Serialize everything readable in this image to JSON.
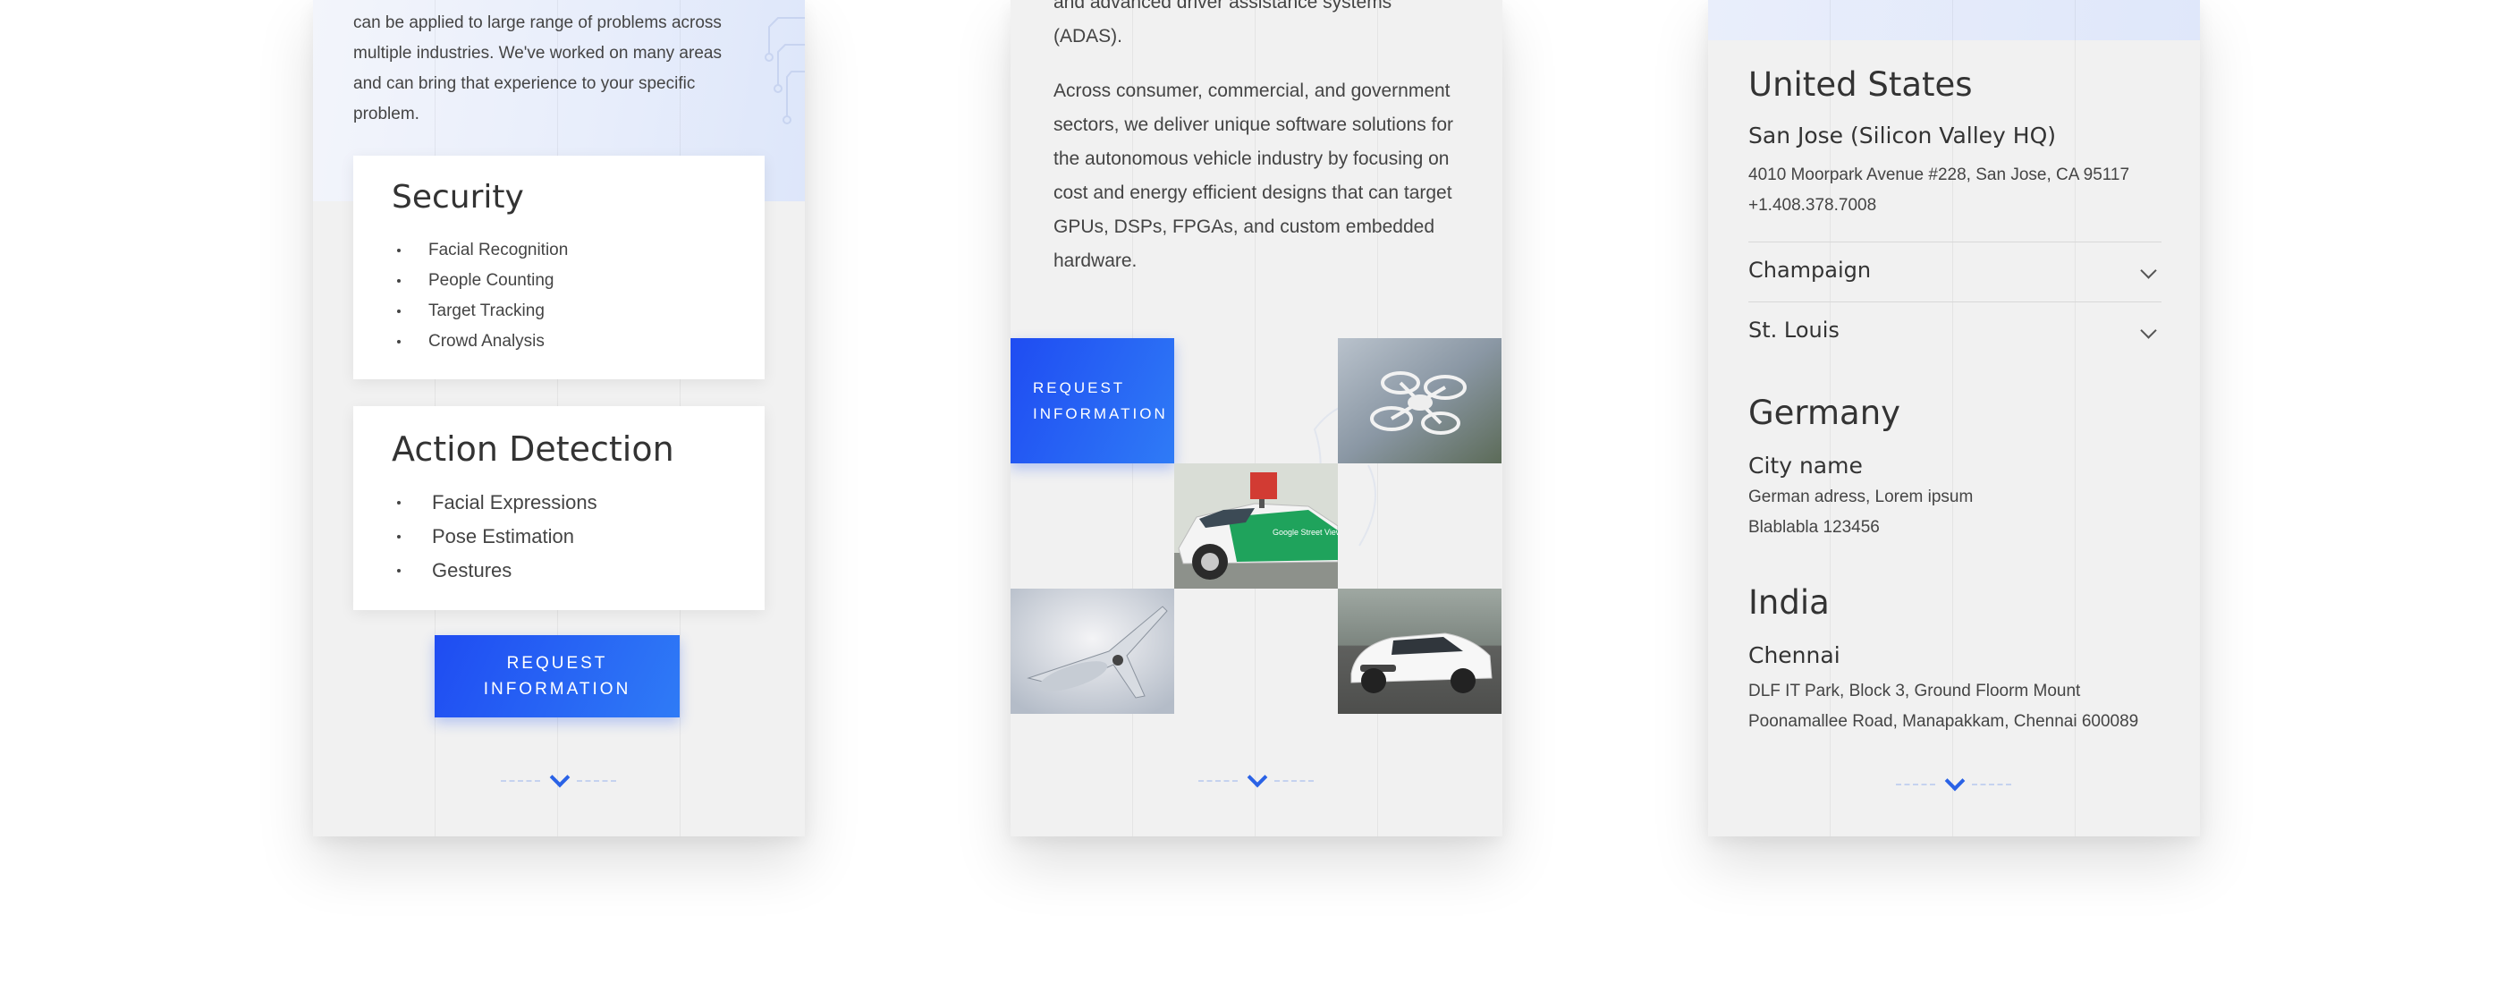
{
  "panel1": {
    "intro_lines": [
      "can be applied to large range of problems across",
      "multiple industries.  We've worked on many areas",
      "and can bring that experience to your specific",
      "problem."
    ],
    "security": {
      "title": "Security",
      "items": [
        "Facial Recognition",
        "People Counting",
        "Target Tracking",
        "Crowd Analysis"
      ]
    },
    "action": {
      "title": "Action Detection",
      "items": [
        "Facial Expressions",
        "Pose Estimation",
        "Gestures"
      ]
    },
    "button": {
      "line1": "REQUEST",
      "line2": "INFORMATION"
    }
  },
  "panel2": {
    "top_lines": [
      "and advanced driver assistance systems",
      "(ADAS)."
    ],
    "para_lines": [
      "Across consumer, commercial, and government",
      "sectors, we deliver unique software solutions for",
      "the autonomous vehicle industry by focusing on",
      "cost and energy efficient designs that can target",
      "GPUs, DSPs, FPGAs, and custom embedded",
      "hardware."
    ],
    "button": {
      "line1": "REQUEST",
      "line2": "INFORMATION"
    },
    "car_brand_text": "Google Street View"
  },
  "panel3": {
    "us": {
      "country": "United States",
      "city": "San Jose (Silicon Valley HQ)",
      "address": "4010 Moorpark Avenue #228, San Jose, CA 95117",
      "phone": "+1.408.378.7008"
    },
    "accordion": [
      {
        "label": "Champaign"
      },
      {
        "label": "St. Louis"
      }
    ],
    "germany": {
      "country": "Germany",
      "city": "City name",
      "address1": "German adress, Lorem ipsum",
      "address2": "Blablabla 123456"
    },
    "india": {
      "country": "India",
      "city": "Chennai",
      "address1": "DLF IT Park, Block 3, Ground Floorm Mount",
      "address2": "Poonamallee Road, Manapakkam, Chennai 600089"
    }
  },
  "colors": {
    "accent": "#2a62e6",
    "button_start": "#1f4cf2",
    "button_end": "#2f7bf6",
    "panel_bg": "#f1f1f1"
  }
}
